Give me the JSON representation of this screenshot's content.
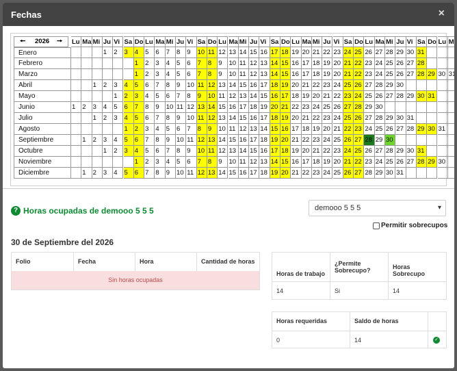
{
  "modal": {
    "title": "Fechas",
    "close": "×"
  },
  "calendar": {
    "year": "2026",
    "prev": "🠔",
    "next": "🠖",
    "day_headers": [
      "Lu",
      "Ma",
      "Mi",
      "Ju",
      "Vi",
      "Sa",
      "Do",
      "Lu",
      "Ma",
      "Mi",
      "Ju",
      "Vi",
      "Sa",
      "Do",
      "Lu",
      "Ma",
      "Mi",
      "Ju",
      "Vi",
      "Sa",
      "Do",
      "Lu",
      "Ma",
      "Mi",
      "Ju",
      "Vi",
      "Sa",
      "Do",
      "Lu",
      "Ma",
      "Mi",
      "Ju",
      "Vi",
      "Sa",
      "Do",
      "Lu",
      "Ma"
    ],
    "months": [
      {
        "name": "Enero",
        "start": 3,
        "days": 31
      },
      {
        "name": "Febrero",
        "start": 6,
        "days": 28
      },
      {
        "name": "Marzo",
        "start": 6,
        "days": 31
      },
      {
        "name": "Abril",
        "start": 2,
        "days": 30
      },
      {
        "name": "Mayo",
        "start": 4,
        "days": 31
      },
      {
        "name": "Junio",
        "start": 0,
        "days": 30
      },
      {
        "name": "Julio",
        "start": 2,
        "days": 31
      },
      {
        "name": "Agosto",
        "start": 5,
        "days": 31
      },
      {
        "name": "Septiembre",
        "start": 1,
        "days": 30
      },
      {
        "name": "Octubre",
        "start": 3,
        "days": 31
      },
      {
        "name": "Noviembre",
        "start": 6,
        "days": 30
      },
      {
        "name": "Diciembre",
        "start": 1,
        "days": 31
      }
    ],
    "highlight_colors": {
      "weekend": "#ffff00",
      "selected": "#1b7a1b",
      "hover": "#6ed62a"
    },
    "selected_day": {
      "month": 8,
      "day": 28
    },
    "hover_day": {
      "month": 8,
      "day": 30
    }
  },
  "ocupadas": {
    "title": "Horas ocupadas de demooo 5 5 5"
  },
  "user_select": {
    "value": "demooo 5 5 5"
  },
  "permitir": {
    "label": "Permitir sobrecupos"
  },
  "date_title": "30 de Septiembre del 2026",
  "table1": {
    "headers": [
      "Folio",
      "Fecha",
      "Hora",
      "Cantidad de horas"
    ],
    "empty": "Sin horas ocupadas"
  },
  "table2": {
    "headers": [
      "Horas de trabajo",
      "¿Permite Sobrecupo?",
      "Horas Sobrecupo"
    ],
    "values": [
      "14",
      "Si",
      "14"
    ]
  },
  "table3": {
    "headers": [
      "Horas requeridas",
      "Saldo de horas",
      ""
    ],
    "values": [
      "0",
      "14",
      ""
    ]
  }
}
